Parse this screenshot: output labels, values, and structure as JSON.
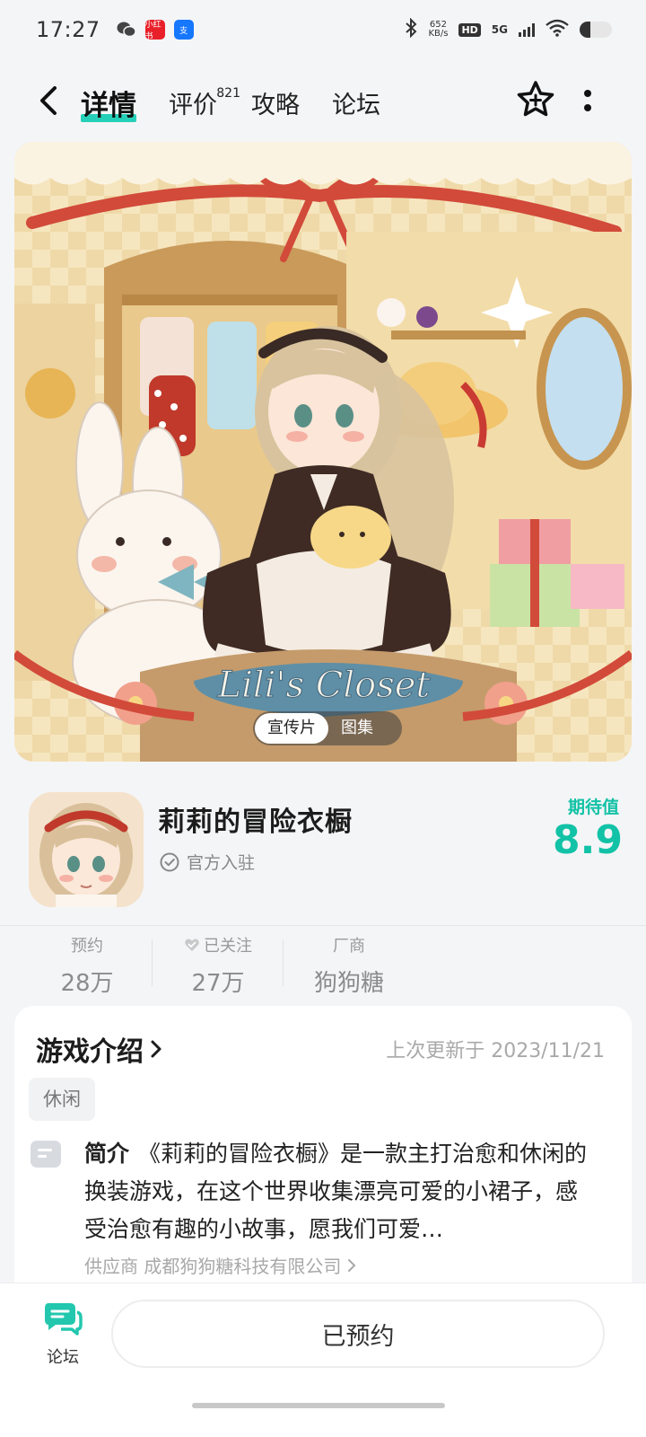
{
  "status_bar": {
    "time": "17:27",
    "notif_icons": [
      "wechat-icon",
      "xiaohongshu-icon",
      "alipay-icon"
    ],
    "xiaohongshu_text": "小红书",
    "alipay_text": "支",
    "net_speed_value": "652",
    "net_speed_unit": "KB/s",
    "hd": "HD",
    "network": "5G"
  },
  "nav": {
    "tabs": [
      {
        "label": "详情",
        "active": true
      },
      {
        "label": "评价",
        "count": "821"
      },
      {
        "label": "攻略"
      },
      {
        "label": "论坛"
      }
    ]
  },
  "banner": {
    "logo_text": "Lili's Closet",
    "media_tabs": [
      {
        "label": "宣传片",
        "active": true
      },
      {
        "label": "图集"
      }
    ]
  },
  "app": {
    "name": "莉莉的冒险衣橱",
    "badge": "官方入驻",
    "score_label": "期待值",
    "score": "8.9"
  },
  "stats": [
    {
      "label": "预约",
      "value": "28万"
    },
    {
      "label": "已关注",
      "value": "27万",
      "icon": "heart-icon"
    },
    {
      "label": "厂商",
      "value": "狗狗糖"
    }
  ],
  "intro": {
    "title": "游戏介绍",
    "updated": "上次更新于 2023/11/21",
    "tag": "休闲",
    "desc_label": "简介",
    "desc": "《莉莉的冒险衣橱》是一款主打治愈和休闲的换装游戏，在这个世界收集漂亮可爱的小裙子，感受治愈有趣的小故事，愿我们可爱…",
    "supplier": "供应商 成都狗狗糖科技有限公司"
  },
  "bottom": {
    "forum_label": "论坛",
    "reserve_label": "已预约"
  },
  "colors": {
    "accent": "#12c2a6",
    "tab_underline": "#26d0b8",
    "background": "#f4f5f7"
  }
}
